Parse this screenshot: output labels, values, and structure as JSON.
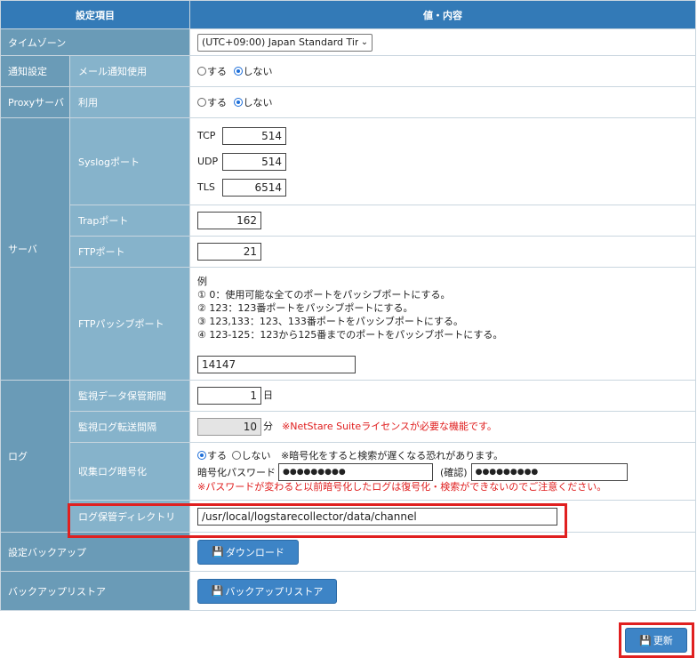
{
  "header": {
    "col_item": "設定項目",
    "col_value": "値・内容"
  },
  "timezone": {
    "label": "タイムゾーン",
    "selected": "(UTC+09:00) Japan Standard Tim"
  },
  "notify": {
    "group": "通知設定",
    "label": "メール通知使用",
    "opt_yes": "する",
    "opt_no": "しない"
  },
  "proxy": {
    "group": "Proxyサーバ",
    "label": "利用",
    "opt_yes": "する",
    "opt_no": "しない"
  },
  "server": {
    "group": "サーバ",
    "syslog": {
      "label": "Syslogポート",
      "tcp_label": "TCP",
      "tcp": "514",
      "udp_label": "UDP",
      "udp": "514",
      "tls_label": "TLS",
      "tls": "6514"
    },
    "trap": {
      "label": "Trapポート",
      "value": "162"
    },
    "ftp": {
      "label": "FTPポート",
      "value": "21"
    },
    "ftp_passive": {
      "label": "FTPパッシブポート",
      "example_title": "例",
      "ex1": "① 0：使用可能な全てのポートをパッシブポートにする。",
      "ex2": "② 123：123番ポートをパッシブポートにする。",
      "ex3": "③ 123,133：123、133番ポートをパッシブポートにする。",
      "ex4": "④ 123-125：123から125番までのポートをパッシブポートにする。",
      "value": "14147"
    }
  },
  "log": {
    "group": "ログ",
    "retention": {
      "label": "監視データ保管期間",
      "value": "1",
      "unit": "日"
    },
    "transfer": {
      "label": "監視ログ転送間隔",
      "value": "10",
      "unit": "分",
      "note": "※NetStare Suiteライセンスが必要な機能です。"
    },
    "encrypt": {
      "label": "収集ログ暗号化",
      "opt_yes": "する",
      "opt_no": "しない",
      "note": "※暗号化をすると検索が遅くなる恐れがあります。",
      "pw_label": "暗号化パスワード",
      "pw_value": "●●●●●●●●●",
      "confirm_label": "(確認)",
      "confirm_value": "●●●●●●●●●",
      "warning": "※パスワードが変わると以前暗号化したログは復号化・検索ができないのでご注意ください。"
    },
    "directory": {
      "label": "ログ保管ディレクトリ",
      "value": "/usr/local/logstarecollector/data/channel"
    }
  },
  "backup": {
    "label": "設定バックアップ",
    "button": "ダウンロード"
  },
  "restore": {
    "label": "バックアップリストア",
    "button": "バックアップリストア"
  },
  "update_button": "更新",
  "icons": {
    "save": "floppy-disk-icon",
    "dropdown": "chevron-down-icon"
  },
  "colors": {
    "header": "#337ab7",
    "group": "#6a9bb7",
    "subgroup": "#86b3cb",
    "highlight": "#e02020",
    "button": "#3d84c6"
  }
}
